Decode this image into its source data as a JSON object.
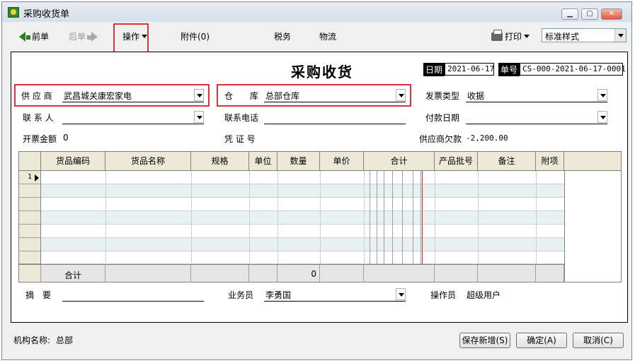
{
  "window": {
    "title": "采购收货单",
    "controls": [
      "minimize",
      "maximize",
      "close"
    ]
  },
  "toolbar": {
    "prev": "前单",
    "next": "后单",
    "operate": "操作",
    "attachments": "附件(0)",
    "tax": "税务",
    "logistics": "物流",
    "print": "打印",
    "style_value": "标准样式"
  },
  "document": {
    "title": "采购收货",
    "date_label": "日期",
    "date_value": "2021-06-17",
    "number_label": "单号",
    "number_value": "CS-000-2021-06-17-0001"
  },
  "fields": {
    "supplier_label": "供 应 商",
    "supplier_value": "武昌城关康宏家电",
    "warehouse_label": "仓　　库",
    "warehouse_value": "总部仓库",
    "invoice_type_label": "发票类型",
    "invoice_type_value": "收据",
    "contact_label": "联 系 人",
    "contact_value": "",
    "phone_label": "联系电话",
    "phone_value": "",
    "pay_date_label": "付款日期",
    "pay_date_value": "",
    "invoice_amount_label": "开票金额",
    "invoice_amount_value": "0",
    "voucher_label": "凭 证 号",
    "voucher_value": "",
    "supplier_debt_label": "供应商欠款",
    "supplier_debt_value": "-2,200.00"
  },
  "grid": {
    "columns": [
      "货品编码",
      "货品名称",
      "规格",
      "单位",
      "数量",
      "单价",
      "合计",
      "产品批号",
      "备注",
      "附项"
    ],
    "rows": [
      {
        "num": "1",
        "cells": [
          "",
          "",
          "",
          "",
          "",
          "",
          "",
          "",
          "",
          ""
        ]
      },
      {
        "num": "",
        "cells": [
          "",
          "",
          "",
          "",
          "",
          "",
          "",
          "",
          "",
          ""
        ]
      },
      {
        "num": "",
        "cells": [
          "",
          "",
          "",
          "",
          "",
          "",
          "",
          "",
          "",
          ""
        ]
      },
      {
        "num": "",
        "cells": [
          "",
          "",
          "",
          "",
          "",
          "",
          "",
          "",
          "",
          ""
        ]
      },
      {
        "num": "",
        "cells": [
          "",
          "",
          "",
          "",
          "",
          "",
          "",
          "",
          "",
          ""
        ]
      },
      {
        "num": "",
        "cells": [
          "",
          "",
          "",
          "",
          "",
          "",
          "",
          "",
          "",
          ""
        ]
      },
      {
        "num": "",
        "cells": [
          "",
          "",
          "",
          "",
          "",
          "",
          "",
          "",
          "",
          ""
        ]
      }
    ],
    "totals_label": "合计",
    "totals_quantity": "0"
  },
  "footer_fields": {
    "summary_label": "摘　要",
    "summary_value": "",
    "salesman_label": "业务员",
    "salesman_value": "李勇国",
    "operator_label": "操作员",
    "operator_value": "超级用户"
  },
  "status": {
    "org_label": "机构名称:",
    "org_value": "总部"
  },
  "buttons": {
    "save_new": "保存新增(S)",
    "confirm": "确定(A)",
    "cancel": "取消(C)"
  },
  "colors": {
    "highlight_border": "#d9343a",
    "grid_alt_row": "#e8f0f0",
    "total_red_line": "#e03030"
  }
}
